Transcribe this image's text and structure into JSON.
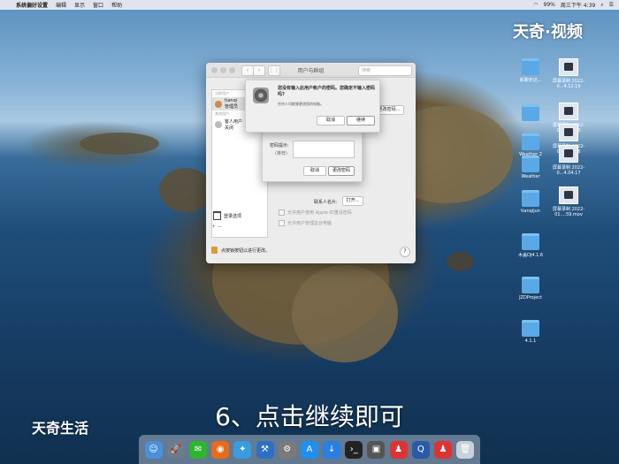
{
  "menubar": {
    "app": "系统偏好设置",
    "items": [
      "编辑",
      "显示",
      "窗口",
      "帮助"
    ],
    "battery": "99%",
    "clock": "周三下午 4:39"
  },
  "watermarks": {
    "top_right": "天奇·视频",
    "bottom_left": "天奇生活"
  },
  "desktop_icons": [
    {
      "label": "新聊天记...",
      "kind": "folder"
    },
    {
      "label": "屏幕录制 2022-0...4.12.19",
      "kind": "screenshot"
    },
    {
      "label": "",
      "kind": "folder"
    },
    {
      "label": "屏幕录制 2022-0...4.08.50",
      "kind": "screenshot"
    },
    {
      "label": "Weather 2",
      "kind": "folder"
    },
    {
      "label": "屏幕录制 2022-0...4.03.46",
      "kind": "screenshot"
    },
    {
      "label": "Weather",
      "kind": "folder"
    },
    {
      "label": "屏幕录制 2022-0...4.04.17",
      "kind": "screenshot"
    },
    {
      "label": "tianqijun",
      "kind": "folder"
    },
    {
      "label": "屏幕录制 2022-01....59.mov",
      "kind": "screenshot"
    },
    {
      "label": "木盖DJ4.1.6",
      "kind": "folder"
    },
    {
      "label": "JZDProject",
      "kind": "folder"
    },
    {
      "label": "4.1.1",
      "kind": "folder"
    }
  ],
  "window": {
    "title": "用户与群组",
    "search_placeholder": "搜索",
    "sidebar": {
      "section_current": "当前用户",
      "current_user": {
        "name": "tianqi",
        "role": "管理员"
      },
      "section_other": "其他用户",
      "other_user": {
        "name": "客人用户",
        "role": "关闭"
      },
      "login_options": "登录选项",
      "add_remove": "+ −"
    },
    "change_password_button": "更改密码...",
    "contacts_card_label": "联系人名片:",
    "open_button": "打开...",
    "checkbox_apple_id": "允许用户使用 Apple ID重设密码",
    "checkbox_admin": "允许用户管理这台电脑",
    "lock_text": "点按锁按钮以进行更改。",
    "help": "?"
  },
  "alert": {
    "message": "您没有输入此用户帐户的密码。您确定不输入密码吗?",
    "detail": "任何人均能够更改您的电脑。",
    "cancel": "取消",
    "continue": "继续"
  },
  "password_sheet": {
    "hint_label": "密码提示:",
    "hint_sub": "(推荐)",
    "cancel": "取消",
    "change_password": "更改密码"
  },
  "subtitle": "6、点击继续即可",
  "dock": [
    "Finder",
    "Launchpad",
    "微信",
    "Firefox",
    "Safari",
    "Xcode",
    "系统偏好设置",
    "App Store",
    "下载",
    "终端",
    "预览",
    "QQ",
    "QuickTime",
    "QQ",
    "废纸篓"
  ]
}
